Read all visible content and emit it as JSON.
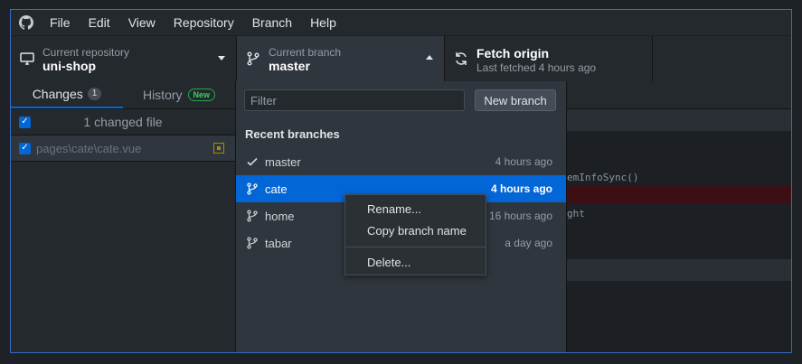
{
  "menubar": {
    "items": [
      "File",
      "Edit",
      "View",
      "Repository",
      "Branch",
      "Help"
    ]
  },
  "toolbar": {
    "repo": {
      "label": "Current repository",
      "value": "uni-shop"
    },
    "branch": {
      "label": "Current branch",
      "value": "master"
    },
    "fetch": {
      "label": "Fetch origin",
      "value": "Last fetched 4 hours ago"
    }
  },
  "sidebar": {
    "tabs": [
      {
        "label": "Changes",
        "badge": "1"
      },
      {
        "label": "History",
        "badge": "New"
      }
    ],
    "changed_summary": "1 changed file",
    "files": [
      {
        "path": "pages\\cate\\cate.vue"
      }
    ]
  },
  "diff": {
    "lines": [
      "emInfoSync()",
      "ght"
    ]
  },
  "dropdown": {
    "filter_placeholder": "Filter",
    "new_branch_label": "New branch",
    "section_title": "Recent branches",
    "branches": [
      {
        "name": "master",
        "time": "4 hours ago",
        "current": true
      },
      {
        "name": "cate",
        "time": "4 hours ago",
        "current": false,
        "selected": true
      },
      {
        "name": "home",
        "time": "16 hours ago",
        "current": false
      },
      {
        "name": "tabar",
        "time": "a day ago",
        "current": false
      }
    ]
  },
  "context_menu": {
    "items": [
      "Rename...",
      "Copy branch name",
      "Delete..."
    ]
  },
  "colors": {
    "accent": "#0366d6",
    "frame_border": "#2f6cc4",
    "background": "#24292e"
  }
}
